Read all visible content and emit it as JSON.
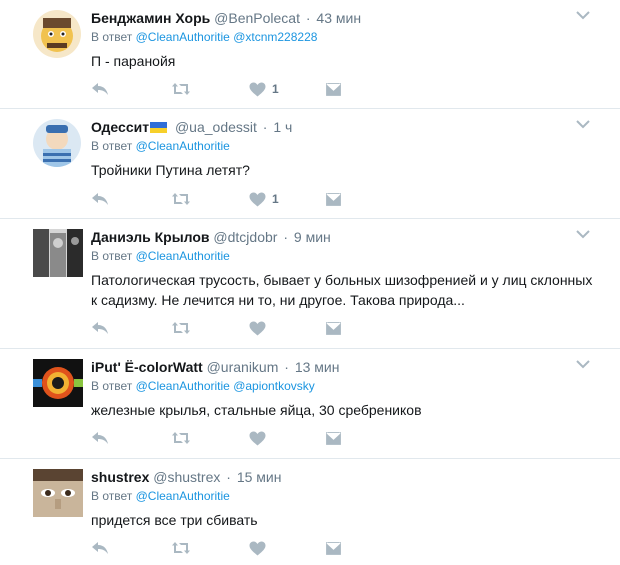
{
  "reply_prefix": "В ответ",
  "tweets": [
    {
      "name": "Бенджамин Хорь",
      "handle": "@BenPolecat",
      "time": "43 мин",
      "mentions": [
        "@CleanAuthoritie",
        "@xtcnm228228"
      ],
      "text": "П - паранойя",
      "likes": "1",
      "avatar_colors": [
        "#f1c24f",
        "#6b4a2e"
      ]
    },
    {
      "name": "Одессит",
      "handle": "@ua_odessit",
      "time": "1 ч",
      "mentions": [
        "@CleanAuthoritie"
      ],
      "text": "Тройники Путина летят?",
      "likes": "1",
      "avatar_colors": [
        "#9fc6e8",
        "#3a6fb0"
      ]
    },
    {
      "name": "Даниэль Крылов",
      "handle": "@dtcjdobr",
      "time": "9 мин",
      "mentions": [
        "@CleanAuthoritie"
      ],
      "text": "Патологическая трусость, бывает у больных шизофренией и у лиц склонных к садизму. Не лечится ни то, ни другое. Такова природа...",
      "likes": "",
      "avatar_colors": [
        "#6e6e6e",
        "#2b2b2b"
      ]
    },
    {
      "name": "iPut' Ë-colorWatt",
      "handle": "@uranikum",
      "time": "13 мин",
      "mentions": [
        "@CleanAuthoritie",
        "@apiontkovsky"
      ],
      "text": "железные крылья, стальные яйца, 30 сребреников",
      "likes": "",
      "avatar_colors": [
        "#e0531c",
        "#1a1a1a"
      ]
    },
    {
      "name": "shustrex",
      "handle": "@shustrex",
      "time": "15 мин",
      "mentions": [
        "@CleanAuthoritie"
      ],
      "text": "придется все три сбивать",
      "likes": "",
      "avatar_colors": [
        "#c9b59b",
        "#5a4432"
      ]
    }
  ],
  "icons": {
    "reply": "reply-icon",
    "retweet": "retweet-icon",
    "like": "heart-icon",
    "dm": "direct-message-icon",
    "more": "chevron-down-icon"
  },
  "colors": {
    "name": "#14171a",
    "meta": "#657786",
    "link": "#1b95e0",
    "icon": "#aab8c2",
    "divider": "#e1e8ed"
  }
}
